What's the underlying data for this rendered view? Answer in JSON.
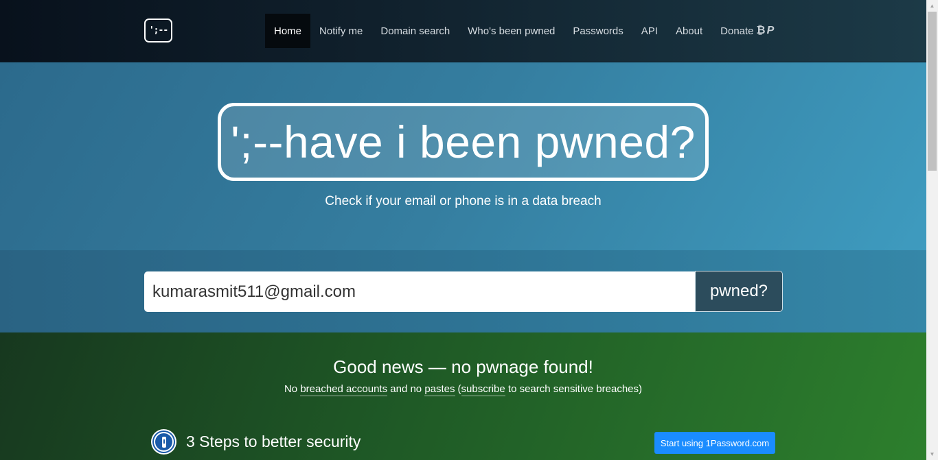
{
  "navbar": {
    "logo_text": "';--",
    "items": [
      {
        "label": "Home",
        "active": true
      },
      {
        "label": "Notify me"
      },
      {
        "label": "Domain search"
      },
      {
        "label": "Who's been pwned"
      },
      {
        "label": "Passwords"
      },
      {
        "label": "API"
      },
      {
        "label": "About"
      },
      {
        "label": "Donate"
      }
    ],
    "donate_icons": [
      "bitcoin-icon",
      "paypal-icon"
    ]
  },
  "hero": {
    "title": "';--have i been pwned?",
    "subtitle": "Check if your email or phone is in a data breach"
  },
  "search": {
    "value": "kumarasmit511@gmail.com",
    "button_label": "pwned?"
  },
  "result": {
    "title": "Good news — no pwnage found!",
    "sub_prefix": "No",
    "link_breached": "breached accounts",
    "sub_mid1": "and no",
    "link_pastes": "pastes",
    "sub_mid2": "(",
    "link_subscribe": "subscribe",
    "sub_suffix": "to search sensitive breaches)"
  },
  "steps": {
    "title": "3 Steps to better security",
    "cta_label": "Start using 1Password.com"
  },
  "colors": {
    "hero_blue": "#357ea0",
    "result_green": "#1f5a26",
    "cta_blue": "#1a8cff",
    "search_button": "#2c4c5c"
  }
}
